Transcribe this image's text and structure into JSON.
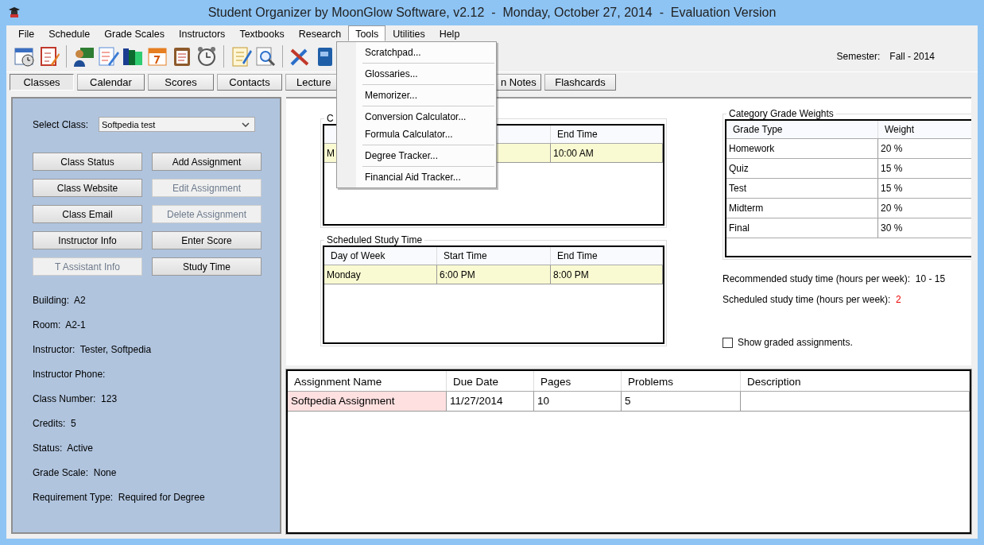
{
  "window": {
    "title": "Student Organizer by MoonGlow Software, v2.12  -  Monday, October 27, 2014  -  Evaluation Version"
  },
  "menu_bar": [
    {
      "label": "File",
      "selected": false
    },
    {
      "label": "Schedule",
      "selected": false
    },
    {
      "label": "Grade Scales",
      "selected": false
    },
    {
      "label": "Instructors",
      "selected": false
    },
    {
      "label": "Textbooks",
      "selected": false
    },
    {
      "label": "Research",
      "selected": false
    },
    {
      "label": "Tools",
      "selected": true
    },
    {
      "label": "Utilities",
      "selected": false
    },
    {
      "label": "Help",
      "selected": false
    }
  ],
  "open_menu": {
    "groups": [
      [
        "Scratchpad..."
      ],
      [
        "Glossaries..."
      ],
      [
        "Memorizer..."
      ],
      [
        "Conversion Calculator...",
        "Formula Calculator..."
      ],
      [
        "Degree Tracker..."
      ],
      [
        "Financial Aid Tracker..."
      ]
    ]
  },
  "semester": {
    "label": "Semester:",
    "value": "Fall - 2014"
  },
  "tabs": [
    {
      "label": "Classes",
      "selected": true
    },
    {
      "label": "Calendar",
      "selected": false
    },
    {
      "label": "Scores",
      "selected": false
    },
    {
      "label": "Contacts",
      "selected": false
    },
    {
      "label": "Lecture",
      "selected": false
    },
    {
      "label": "n Notes",
      "selected": false
    },
    {
      "label": "Flashcards",
      "selected": false
    }
  ],
  "class_panel": {
    "select_label": "Select Class:",
    "select_value": "Softpedia test",
    "buttons": [
      {
        "label": "Class Status",
        "disabled": false
      },
      {
        "label": "Add Assignment",
        "disabled": false
      },
      {
        "label": "Class Website",
        "disabled": false
      },
      {
        "label": "Edit Assignment",
        "disabled": true
      },
      {
        "label": "Class Email",
        "disabled": false
      },
      {
        "label": "Delete Assignment",
        "disabled": true
      },
      {
        "label": "Instructor Info",
        "disabled": false
      },
      {
        "label": "Enter Score",
        "disabled": false
      },
      {
        "label": "T Assistant Info",
        "disabled": true
      },
      {
        "label": "Study Time",
        "disabled": false
      }
    ],
    "details": [
      {
        "label": "Building:",
        "value": "A2"
      },
      {
        "label": "Room:",
        "value": "A2-1"
      },
      {
        "label": "Instructor:",
        "value": "Tester,  Softpedia"
      },
      {
        "label": "Instructor Phone:"
      },
      {
        "label": "Class Number:",
        "value": "123"
      },
      {
        "label": "Credits:",
        "value": "5"
      },
      {
        "label": "Status:",
        "value": "Active"
      },
      {
        "label": "Grade Scale:",
        "value": "None"
      },
      {
        "label": "Requirement Type:",
        "value": "Required for Degree"
      }
    ]
  },
  "class_times": {
    "legend": "C",
    "columns": [
      null,
      null,
      "End Time"
    ],
    "rows": [
      {
        "cells": [
          "M",
          null,
          "10:00 AM"
        ],
        "selected": true
      }
    ]
  },
  "study_time": {
    "legend": "Scheduled Study Time",
    "columns": [
      "Day of Week",
      "Start Time",
      "End Time"
    ],
    "rows": [
      {
        "cells": [
          "Monday",
          "6:00 PM",
          "8:00 PM"
        ],
        "selected": true
      }
    ]
  },
  "grade_weights": {
    "legend": "Category Grade Weights",
    "columns": [
      "Grade Type",
      "Weight"
    ],
    "rows": [
      [
        "Homework",
        "20 %"
      ],
      [
        "Quiz",
        "15 %"
      ],
      [
        "Test",
        "15 %"
      ],
      [
        "Midterm",
        "20 %"
      ],
      [
        "Final",
        "30 %"
      ]
    ]
  },
  "recommended": {
    "label": "Recommended study time (hours per week):",
    "value": "10 - 15"
  },
  "scheduled": {
    "label": "Scheduled study time (hours per week):",
    "value": "2"
  },
  "show_graded": {
    "label": "Show graded assignments.",
    "checked": false
  },
  "assignments": {
    "columns": [
      "Assignment Name",
      "Due Date",
      "Pages",
      "Problems",
      "Description"
    ],
    "rows": [
      {
        "cells": [
          "Softpedia Assignment",
          "11/27/2014",
          "10",
          "5"
        ],
        "selected": true
      }
    ]
  }
}
